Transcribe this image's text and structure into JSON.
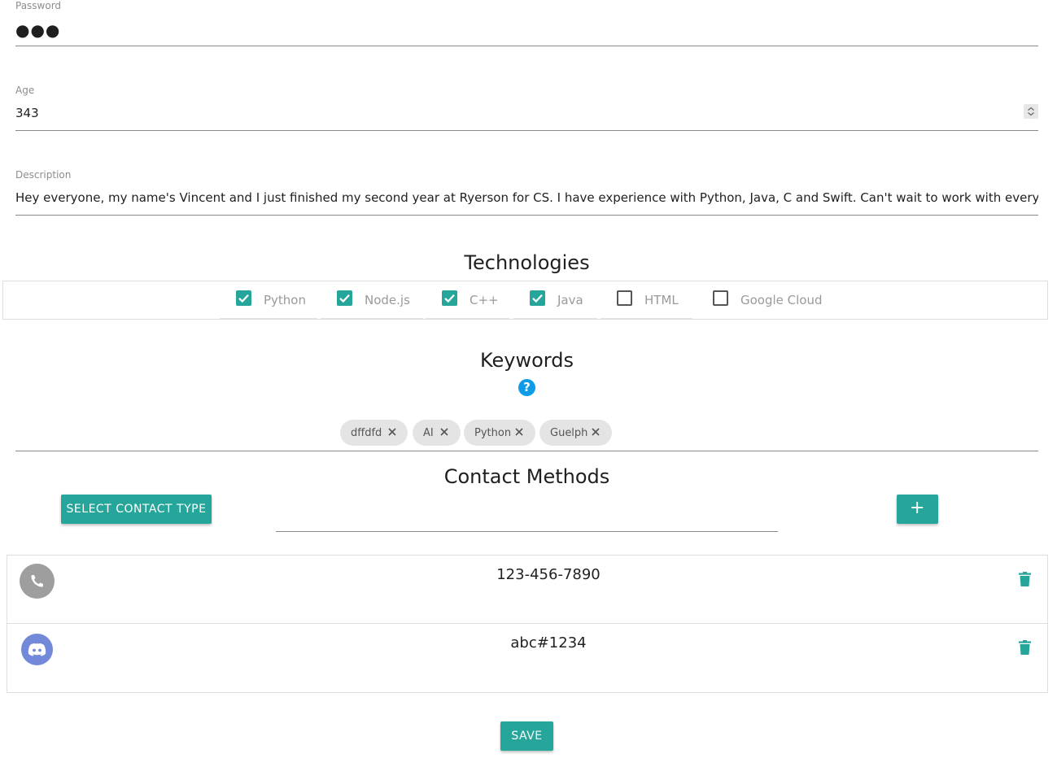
{
  "form": {
    "password": {
      "label": "Password",
      "value": "●●●"
    },
    "age": {
      "label": "Age",
      "value": "343"
    },
    "description": {
      "label": "Description",
      "value": "Hey everyone, my name's Vincent and I just finished my second year at Ryerson for CS. I have experience with Python, Java, C and Swift. Can't wait to work with everyone this week"
    }
  },
  "technologies": {
    "title": "Technologies",
    "items": [
      {
        "label": "Python",
        "checked": true
      },
      {
        "label": "Node.js",
        "checked": true
      },
      {
        "label": "C++",
        "checked": true
      },
      {
        "label": "Java",
        "checked": true
      },
      {
        "label": "HTML",
        "checked": false
      },
      {
        "label": "Google Cloud",
        "checked": false
      }
    ]
  },
  "keywords": {
    "title": "Keywords",
    "help_icon": "question-icon",
    "chips": [
      {
        "label": "dffdfd"
      },
      {
        "label": "AI"
      },
      {
        "label": "Python"
      },
      {
        "label": "Guelph"
      }
    ]
  },
  "contacts": {
    "title": "Contact Methods",
    "select_label": "SELECT CONTACT TYPE",
    "add_label": "+",
    "input_value": "",
    "items": [
      {
        "type": "phone",
        "icon": "phone-icon",
        "value": "123-456-7890"
      },
      {
        "type": "discord",
        "icon": "discord-icon",
        "value": "abc#1234"
      }
    ]
  },
  "save_label": "SAVE",
  "colors": {
    "accent": "#26a69a",
    "help": "#0e9be8",
    "discord": "#7289da",
    "phone_avatar": "#9e9e9e"
  }
}
